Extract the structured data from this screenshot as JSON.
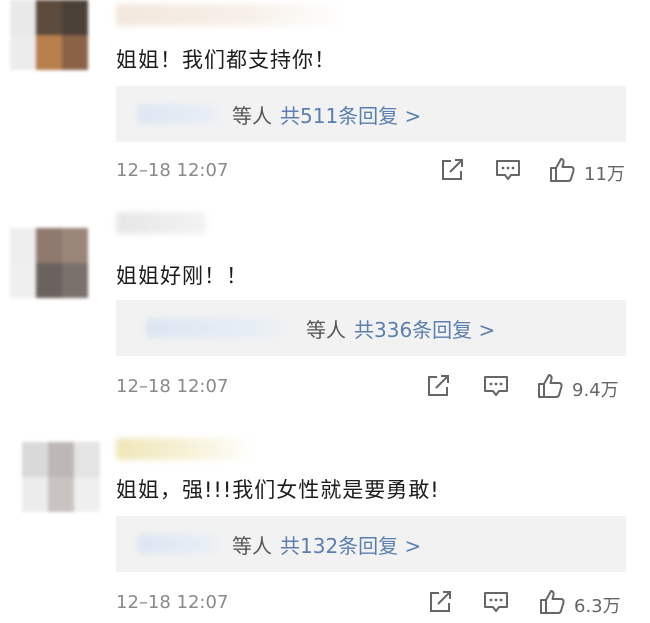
{
  "comments": [
    {
      "text": "姐姐！我们都支持你！",
      "reply_who": "等人",
      "reply_count": "共511条回复 >",
      "time": "12–18 12:07",
      "likes": "11万",
      "icons": [
        "share-icon",
        "comment-icon",
        "like-icon"
      ]
    },
    {
      "text": "姐姐好刚！！",
      "reply_who": "等人",
      "reply_count": "共336条回复 >",
      "time": "12–18 12:07",
      "likes": "9.4万",
      "icons": [
        "share-icon",
        "comment-icon",
        "like-icon"
      ]
    },
    {
      "text": "姐姐，强!!!我们女性就是要勇敢!",
      "reply_who": "等人",
      "reply_count": "共132条回复 >",
      "time": "12–18 12:07",
      "likes": "6.3万",
      "icons": [
        "share-icon",
        "comment-icon",
        "like-icon"
      ]
    }
  ],
  "colors": {
    "reply_link": "#5a7fb0",
    "reply_box_bg": "#f2f2f2",
    "meta_text": "#8a8a8a"
  }
}
